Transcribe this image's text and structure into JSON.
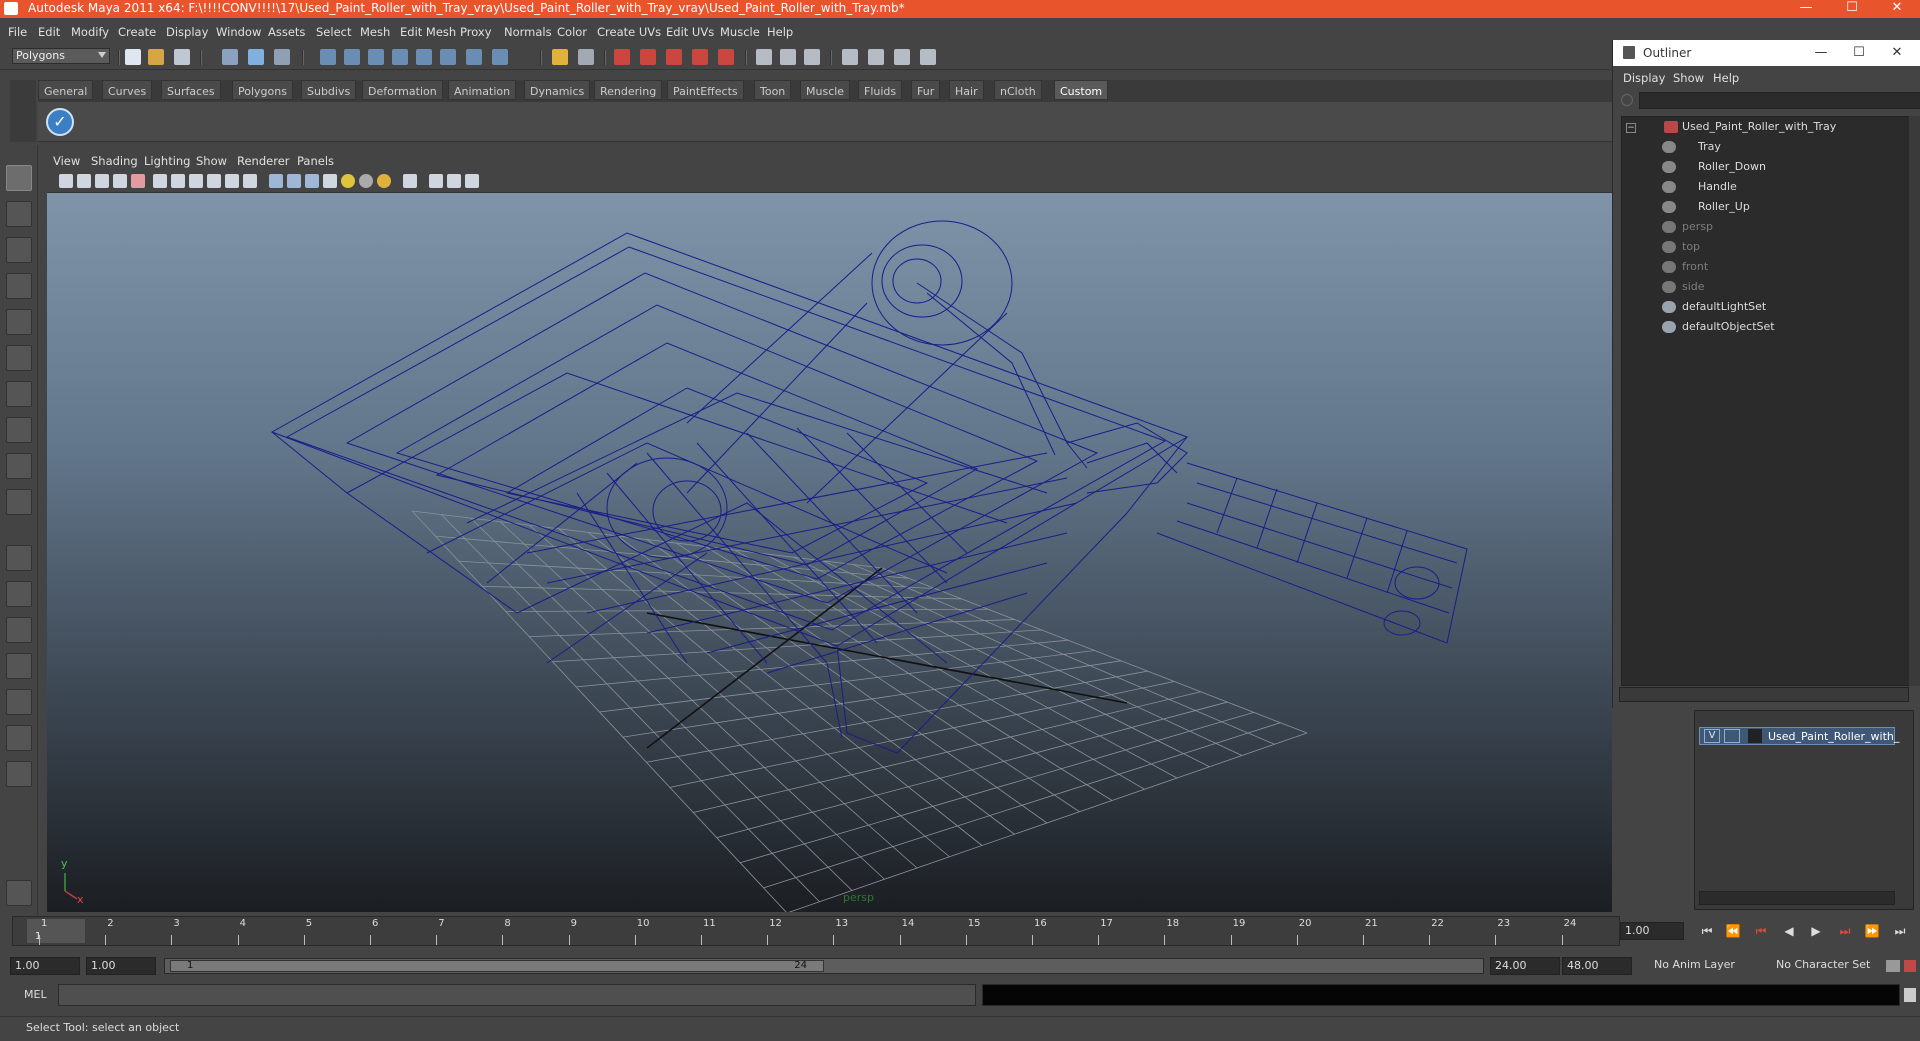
{
  "window": {
    "title": "Autodesk Maya 2011 x64: F:\\!!!!CONV!!!!\\17\\Used_Paint_Roller_with_Tray_vray\\Used_Paint_Roller_with_Tray_vray\\Used_Paint_Roller_with_Tray.mb*",
    "minimize": "—",
    "maximize": "☐",
    "close": "✕"
  },
  "menubar": [
    "File",
    "Edit",
    "Modify",
    "Create",
    "Display",
    "Window",
    "Assets",
    "Select",
    "Mesh",
    "Edit Mesh",
    "Proxy",
    "Normals",
    "Color",
    "Create UVs",
    "Edit UVs",
    "Muscle",
    "Help"
  ],
  "mode_select": "Polygons",
  "shelf_tabs": [
    "General",
    "Curves",
    "Surfaces",
    "Polygons",
    "Subdivs",
    "Deformation",
    "Animation",
    "Dynamics",
    "Rendering",
    "PaintEffects",
    "Toon",
    "Muscle",
    "Fluids",
    "Fur",
    "Hair",
    "nCloth",
    "Custom"
  ],
  "shelf_active": "Custom",
  "panel_menu": [
    "View",
    "Shading",
    "Lighting",
    "Show",
    "Renderer",
    "Panels"
  ],
  "viewport": {
    "camera_label": "persp",
    "axis_y": "y",
    "axis_x": "x",
    "wire_color": "#1a1c8a"
  },
  "outliner": {
    "title": "Outliner",
    "menu": [
      "Display",
      "Show",
      "Help"
    ],
    "items": [
      {
        "label": "Used_Paint_Roller_with_Tray",
        "indent": 0,
        "dim": false,
        "kind": "mesh"
      },
      {
        "label": "Tray",
        "indent": 1,
        "dim": false,
        "kind": "mesh"
      },
      {
        "label": "Roller_Down",
        "indent": 1,
        "dim": false,
        "kind": "mesh"
      },
      {
        "label": "Handle",
        "indent": 1,
        "dim": false,
        "kind": "mesh"
      },
      {
        "label": "Roller_Up",
        "indent": 1,
        "dim": false,
        "kind": "mesh"
      },
      {
        "label": "persp",
        "indent": 0,
        "dim": true,
        "kind": "camera"
      },
      {
        "label": "top",
        "indent": 0,
        "dim": true,
        "kind": "camera"
      },
      {
        "label": "front",
        "indent": 0,
        "dim": true,
        "kind": "camera"
      },
      {
        "label": "side",
        "indent": 0,
        "dim": true,
        "kind": "camera"
      },
      {
        "label": "defaultLightSet",
        "indent": 0,
        "dim": false,
        "kind": "set"
      },
      {
        "label": "defaultObjectSet",
        "indent": 0,
        "dim": false,
        "kind": "set"
      }
    ]
  },
  "layers": {
    "visible_flag": "V",
    "layer_name": "Used_Paint_Roller_with_"
  },
  "timeline": {
    "ticks": [
      "1",
      "2",
      "3",
      "4",
      "5",
      "6",
      "7",
      "8",
      "9",
      "10",
      "11",
      "12",
      "13",
      "14",
      "15",
      "16",
      "17",
      "18",
      "19",
      "20",
      "21",
      "22",
      "23",
      "24"
    ],
    "current_frame_marker": "1",
    "current_frame": "1.00"
  },
  "playback": [
    "⏮",
    "⏪",
    "⏮",
    "◀",
    "▶",
    "⏭",
    "⏩",
    "⏭"
  ],
  "range": {
    "start": "1.00",
    "anim_start": "1.00",
    "slider_start": "1",
    "slider_end": "24",
    "end": "24.00",
    "anim_end": "48.00",
    "anim_layer": "No Anim Layer",
    "character_set": "No Character Set"
  },
  "cmdline": {
    "label": "MEL"
  },
  "helpline": {
    "text": "Select Tool: select an object"
  }
}
